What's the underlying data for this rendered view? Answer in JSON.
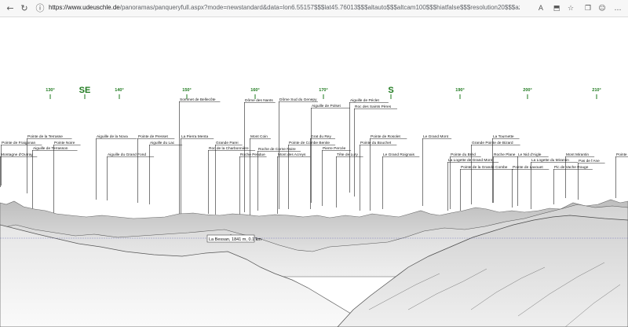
{
  "browser": {
    "url_host": "https://www.udeuschle.de",
    "url_path": "/panoramas/panqueryfull.aspx?mode=newstandard&data=lon6.55157$$$lat45.76013$$$altauto$$$altcam100$$$hiatfalse$$$resolution20$$$azimut160$$$sweep360$$$leftbound0$$$rightbound...",
    "icons": [
      "back-icon",
      "reload-icon",
      "info-icon",
      "translate-icon",
      "extension-icon",
      "star-icon",
      "collections-icon",
      "more-icon"
    ]
  },
  "compass": [
    {
      "label": "130°",
      "major": false
    },
    {
      "label": "SE",
      "major": true
    },
    {
      "label": "140°",
      "major": false
    },
    {
      "label": "150°",
      "major": false
    },
    {
      "label": "160°",
      "major": false
    },
    {
      "label": "170°",
      "major": false
    },
    {
      "label": "S",
      "major": true
    },
    {
      "label": "190°",
      "major": false
    },
    {
      "label": "200°",
      "major": false
    },
    {
      "label": "210°",
      "major": false
    }
  ],
  "peaks": [
    "Montagne d'Outray",
    "Pointe de Fraigonan",
    "Pointe de la Terrasse",
    "Aiguille de Terrasson",
    "Pointe Noire",
    "Aiguille de la Nova",
    "Aiguille du Grand Fond",
    "Pointe de Presset",
    "Aiguille du Lac",
    "Sommet de Bellecôte",
    "La Pierra Menta",
    "Roc de la Charbonnière",
    "Grande Parei",
    "Mont Coin",
    "Roche Pendue",
    "Dôme des Nants",
    "Roche de Corne Noire",
    "Mont des Acreys",
    "Dôme Sud du Genepy",
    "Pointe de Combe Benite",
    "Aiguille de Polset",
    "Grat du Rey",
    "Pierre Percée",
    "Aiguille de Péclet",
    "Roc des Saints Pères",
    "Tête de Lury",
    "Pointe du Bouchet",
    "Pointe de Rosolet",
    "Le Grand Roignais",
    "Le Grand Mont",
    "Pointe du Bréd",
    "La Logette de Grand Mont",
    "Pointe de la Grande Combe",
    "Grande Pointe de Bizard",
    "La Tournette",
    "Roche Plane",
    "Pointe de Lavouet",
    "Le Nid d'Aigle",
    "La Logette du Mirantin",
    "Pic de Vache Rouge",
    "Mont Mirantin",
    "Pas de l'Ane",
    "Pointe"
  ],
  "marker": {
    "label": "La Bessan, 1841 m, 0.1 km"
  },
  "colors": {
    "compass": "#1e7a1e",
    "leader": "#222222",
    "horizon": "#6a6fb6"
  }
}
